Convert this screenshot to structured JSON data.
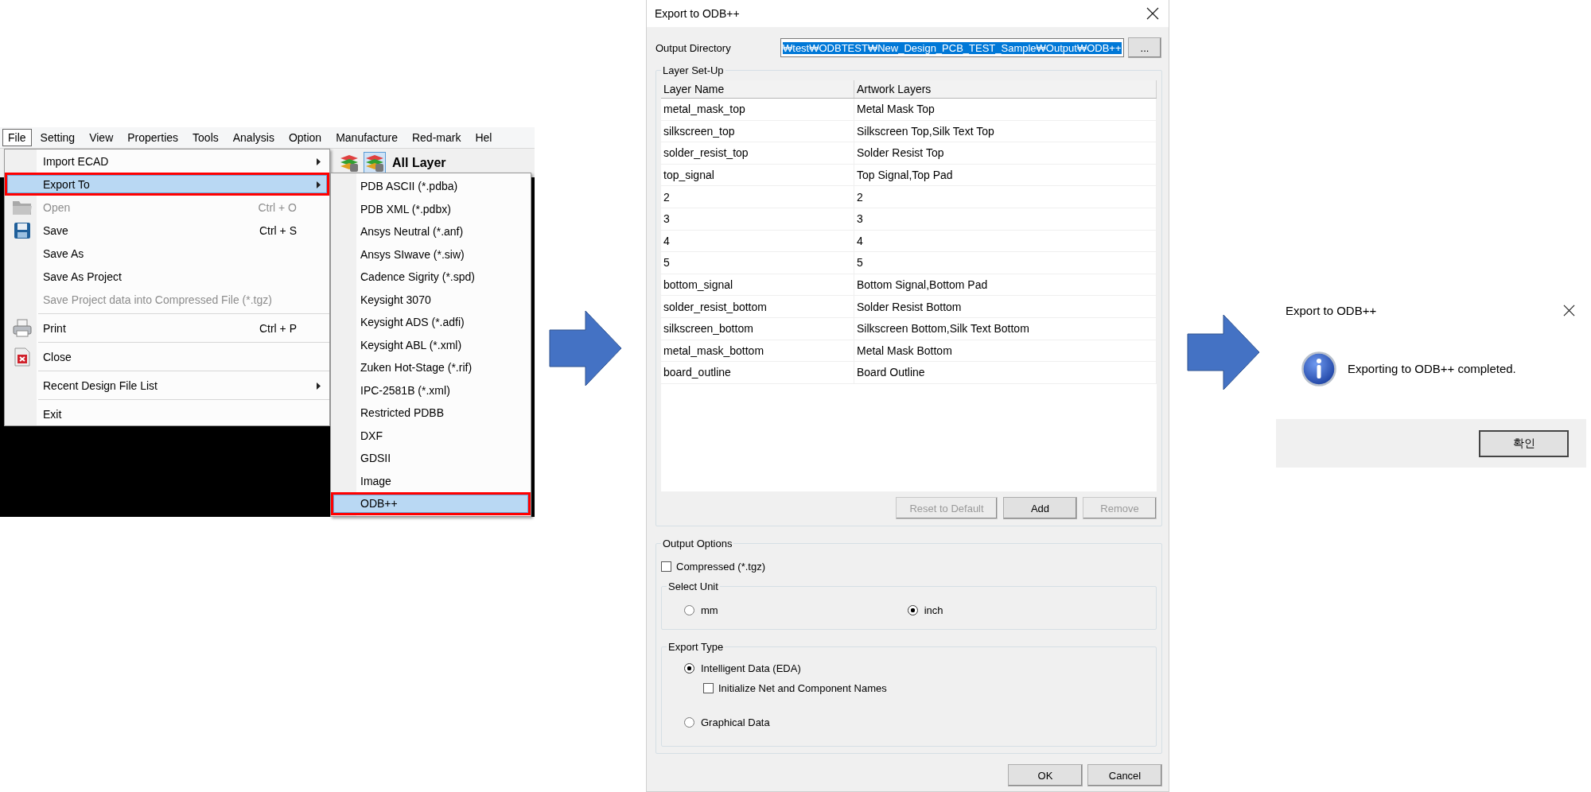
{
  "menu_screen": {
    "menubar": [
      {
        "label": "File",
        "selected": true
      },
      {
        "label": "Setting",
        "selected": false
      },
      {
        "label": "View",
        "selected": false
      },
      {
        "label": "Properties",
        "selected": false
      },
      {
        "label": "Tools",
        "selected": false
      },
      {
        "label": "Analysis",
        "selected": false
      },
      {
        "label": "Option",
        "selected": false
      },
      {
        "label": "Manufacture",
        "selected": false
      },
      {
        "label": "Red-mark",
        "selected": false
      },
      {
        "label": "Hel",
        "selected": false
      }
    ],
    "toolbar": {
      "layer_label": "All Layer"
    },
    "file_menu": [
      {
        "kind": "item",
        "label": "Import ECAD",
        "submenu": true,
        "disabled": false,
        "selected": false,
        "highlighted": false
      },
      {
        "kind": "item",
        "label": "Export To",
        "submenu": true,
        "disabled": false,
        "selected": true,
        "highlighted": true
      },
      {
        "kind": "item",
        "label": "Open",
        "shortcut": "Ctrl + O",
        "submenu": false,
        "disabled": true,
        "selected": false,
        "highlighted": false
      },
      {
        "kind": "item",
        "label": "Save",
        "shortcut": "Ctrl + S",
        "submenu": false,
        "disabled": false,
        "selected": false,
        "highlighted": false
      },
      {
        "kind": "item",
        "label": "Save As",
        "submenu": false,
        "disabled": false,
        "selected": false,
        "highlighted": false
      },
      {
        "kind": "item",
        "label": "Save As Project",
        "submenu": false,
        "disabled": false,
        "selected": false,
        "highlighted": false
      },
      {
        "kind": "item",
        "label": "Save Project data into Compressed File (*.tgz)",
        "submenu": false,
        "disabled": true,
        "selected": false,
        "highlighted": false
      },
      {
        "kind": "separator"
      },
      {
        "kind": "item",
        "label": "Print",
        "shortcut": "Ctrl + P",
        "submenu": false,
        "disabled": false,
        "selected": false,
        "highlighted": false
      },
      {
        "kind": "separator"
      },
      {
        "kind": "item",
        "label": "Close",
        "submenu": false,
        "disabled": false,
        "selected": false,
        "highlighted": false
      },
      {
        "kind": "separator"
      },
      {
        "kind": "item",
        "label": "Recent Design File List",
        "submenu": true,
        "disabled": false,
        "selected": false,
        "highlighted": false
      },
      {
        "kind": "separator"
      },
      {
        "kind": "item",
        "label": "Exit",
        "submenu": false,
        "disabled": false,
        "selected": false,
        "highlighted": false
      }
    ],
    "export_submenu": [
      {
        "label": "PDB ASCII (*.pdba)",
        "selected": false,
        "highlighted": false
      },
      {
        "label": "PDB XML (*.pdbx)",
        "selected": false,
        "highlighted": false
      },
      {
        "label": "Ansys Neutral (*.anf)",
        "selected": false,
        "highlighted": false
      },
      {
        "label": "Ansys SIwave (*.siw)",
        "selected": false,
        "highlighted": false
      },
      {
        "label": "Cadence Sigrity (*.spd)",
        "selected": false,
        "highlighted": false
      },
      {
        "label": "Keysight 3070",
        "selected": false,
        "highlighted": false
      },
      {
        "label": "Keysight ADS (*.adfi)",
        "selected": false,
        "highlighted": false
      },
      {
        "label": "Keysight ABL (*.xml)",
        "selected": false,
        "highlighted": false
      },
      {
        "label": "Zuken Hot-Stage (*.rif)",
        "selected": false,
        "highlighted": false
      },
      {
        "label": "IPC-2581B (*.xml)",
        "selected": false,
        "highlighted": false
      },
      {
        "label": "Restricted PDBB",
        "selected": false,
        "highlighted": false
      },
      {
        "label": "DXF",
        "selected": false,
        "highlighted": false
      },
      {
        "label": "GDSII",
        "selected": false,
        "highlighted": false
      },
      {
        "label": "Image",
        "selected": false,
        "highlighted": false
      },
      {
        "label": "ODB++",
        "selected": true,
        "highlighted": true
      }
    ]
  },
  "export_dialog": {
    "title": "Export to ODB++",
    "output_directory": {
      "label": "Output Directory",
      "value": "₩test₩ODBTEST₩New_Design_PCB_TEST_Sample₩Output₩ODB++",
      "text_selected": true,
      "browse": "..."
    },
    "layer_setup": {
      "title": "Layer Set-Up",
      "columns": [
        "Layer Name",
        "Artwork Layers"
      ],
      "rows": [
        [
          "metal_mask_top",
          "Metal Mask Top"
        ],
        [
          "silkscreen_top",
          "Silkscreen Top,Silk Text Top"
        ],
        [
          "solder_resist_top",
          "Solder Resist Top"
        ],
        [
          "top_signal",
          "Top Signal,Top Pad"
        ],
        [
          "2",
          "2"
        ],
        [
          "3",
          "3"
        ],
        [
          "4",
          "4"
        ],
        [
          "5",
          "5"
        ],
        [
          "bottom_signal",
          "Bottom Signal,Bottom Pad"
        ],
        [
          "solder_resist_bottom",
          "Solder Resist Bottom"
        ],
        [
          "silkscreen_bottom",
          "Silkscreen Bottom,Silk Text Bottom"
        ],
        [
          "metal_mask_bottom",
          "Metal Mask Bottom"
        ],
        [
          "board_outline",
          "Board Outline"
        ]
      ],
      "buttons": [
        {
          "label": "Reset to Default",
          "disabled": true
        },
        {
          "label": "Add",
          "disabled": false
        },
        {
          "label": "Remove",
          "disabled": true
        }
      ]
    },
    "output_options": {
      "title": "Output Options",
      "compressed": {
        "label": "Compressed (*.tgz)",
        "checked": false
      },
      "select_unit": {
        "title": "Select Unit",
        "options": [
          {
            "label": "mm",
            "selected": false
          },
          {
            "label": "inch",
            "selected": true
          }
        ]
      },
      "export_type": {
        "title": "Export Type",
        "options": [
          {
            "label": "Intelligent Data (EDA)",
            "selected": true
          },
          {
            "label": "Graphical Data",
            "selected": false
          }
        ],
        "initialize_names": {
          "label": "Initialize Net and Component Names",
          "checked": false
        }
      }
    },
    "buttons": [
      "OK",
      "Cancel"
    ]
  },
  "message_box": {
    "title": "Export to ODB++",
    "message": "Exporting to ODB++ completed.",
    "button": "확인"
  }
}
